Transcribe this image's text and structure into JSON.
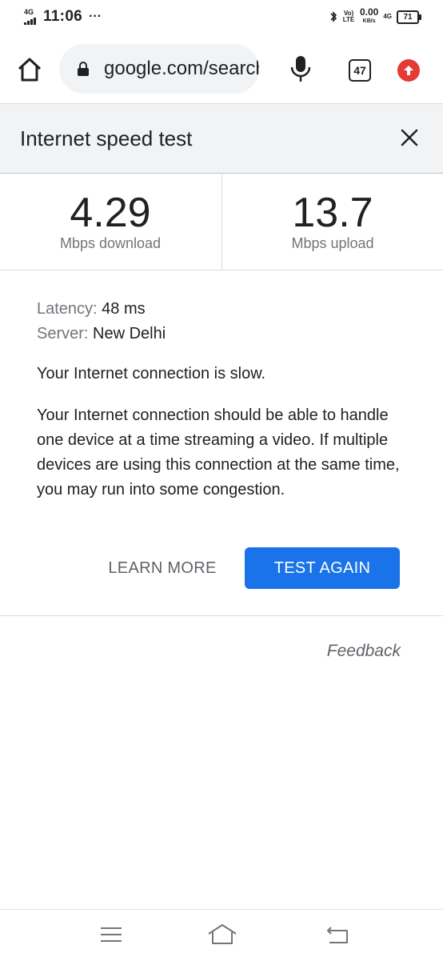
{
  "status_bar": {
    "network": "4G",
    "time": "11:06",
    "dots": "···",
    "volte": "Vo) LTE",
    "speed_value": "0.00",
    "speed_unit": "KB/s",
    "data_net": "4G",
    "battery": "71"
  },
  "browser": {
    "url": "google.com/search",
    "tab_count": "47"
  },
  "card": {
    "title": "Internet speed test",
    "download_value": "4.29",
    "download_unit": "Mbps download",
    "upload_value": "13.7",
    "upload_unit": "Mbps upload",
    "latency_label": "Latency:",
    "latency_value": "48 ms",
    "server_label": "Server:",
    "server_value": "New Delhi",
    "verdict": "Your Internet connection is slow.",
    "description": "Your Internet connection should be able to handle one device at a time streaming a video. If multiple devices are using this connection at the same time, you may run into some congestion.",
    "learn_more": "LEARN MORE",
    "test_again": "TEST AGAIN",
    "feedback": "Feedback"
  },
  "colors": {
    "accent": "#1a73e8",
    "update_badge": "#e53935"
  },
  "icons": [
    "home-icon",
    "lock-icon",
    "mic-icon",
    "tabs-icon",
    "update-icon",
    "close-icon",
    "menu-icon",
    "nav-home-icon",
    "back-icon",
    "bluetooth-icon"
  ]
}
